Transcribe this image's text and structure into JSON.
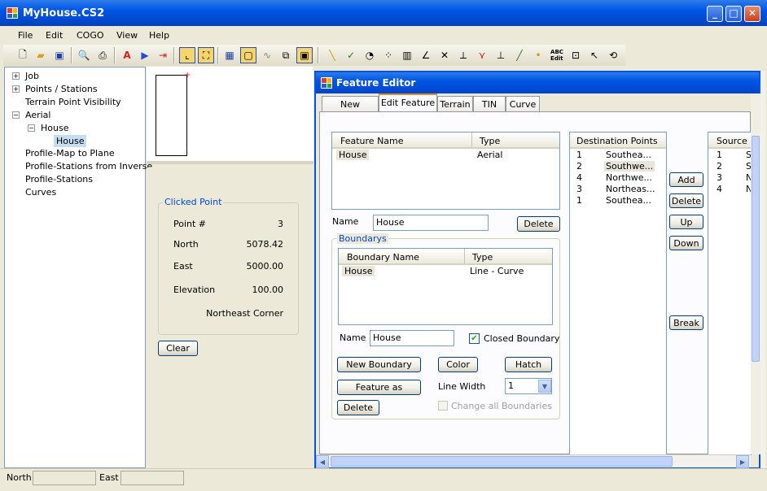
{
  "window": {
    "title": "MyHouse.CS2"
  },
  "menu": [
    "File",
    "Edit",
    "COGO",
    "View",
    "Help"
  ],
  "tree": {
    "items": [
      "Job",
      "Points / Stations",
      "Terrain Point Visibility",
      "Aerial",
      "House",
      "House",
      "Profile-Map to Plane",
      "Profile-Stations from Inverse",
      "Profile-Stations",
      "Curves"
    ]
  },
  "clicked_point": {
    "title": "Clicked Point",
    "point_label": "Point #",
    "point_value": "3",
    "north_label": "North",
    "north_value": "5078.42",
    "east_label": "East",
    "east_value": "5000.00",
    "elev_label": "Elevation",
    "elev_value": "100.00",
    "description": "Northeast Corner",
    "clear_label": "Clear"
  },
  "editor": {
    "title": "Feature Editor",
    "tabs": [
      "New Feature",
      "Edit Feature",
      "Terrain",
      "TIN",
      "Curve"
    ],
    "features": {
      "headers": [
        "Feature Name",
        "Type"
      ],
      "rows": [
        {
          "name": "House",
          "type": "Aerial"
        }
      ]
    },
    "name_label": "Name",
    "name_value": "House",
    "delete_label": "Delete",
    "boundaries": {
      "title": "Boundarys",
      "headers": [
        "Boundary Name",
        "Type"
      ],
      "rows": [
        {
          "name": "House",
          "type": "Line - Curve"
        }
      ],
      "name_label": "Name",
      "name_value": "House",
      "closed_label": "Closed Boundary",
      "closed_checked": true,
      "new_boundary": "New Boundary",
      "color": "Color",
      "hatch": "Hatch",
      "feature_as": "Feature as",
      "line_width_label": "Line Width",
      "line_width_value": "1",
      "delete": "Delete",
      "change_all": "Change all Boundaries"
    },
    "destination": {
      "title": "Destination Points",
      "rows": [
        {
          "num": "1",
          "name": "Southea..."
        },
        {
          "num": "2",
          "name": "Southwe..."
        },
        {
          "num": "4",
          "name": "Northwe..."
        },
        {
          "num": "3",
          "name": "Northeas..."
        },
        {
          "num": "1",
          "name": "Southea..."
        }
      ]
    },
    "buttons": {
      "add": "Add",
      "delete": "Delete",
      "up": "Up",
      "down": "Down",
      "break": "Break"
    },
    "source": {
      "title": "Source F",
      "rows": [
        {
          "num": "1",
          "name": "S"
        },
        {
          "num": "2",
          "name": "S"
        },
        {
          "num": "3",
          "name": "N"
        },
        {
          "num": "4",
          "name": "N"
        }
      ]
    }
  },
  "status": {
    "north_label": "North",
    "east_label": "East"
  },
  "colors": {
    "xp_blue": "#0054E3",
    "selection": "#E8E6DA",
    "accent": "#0046D5"
  }
}
